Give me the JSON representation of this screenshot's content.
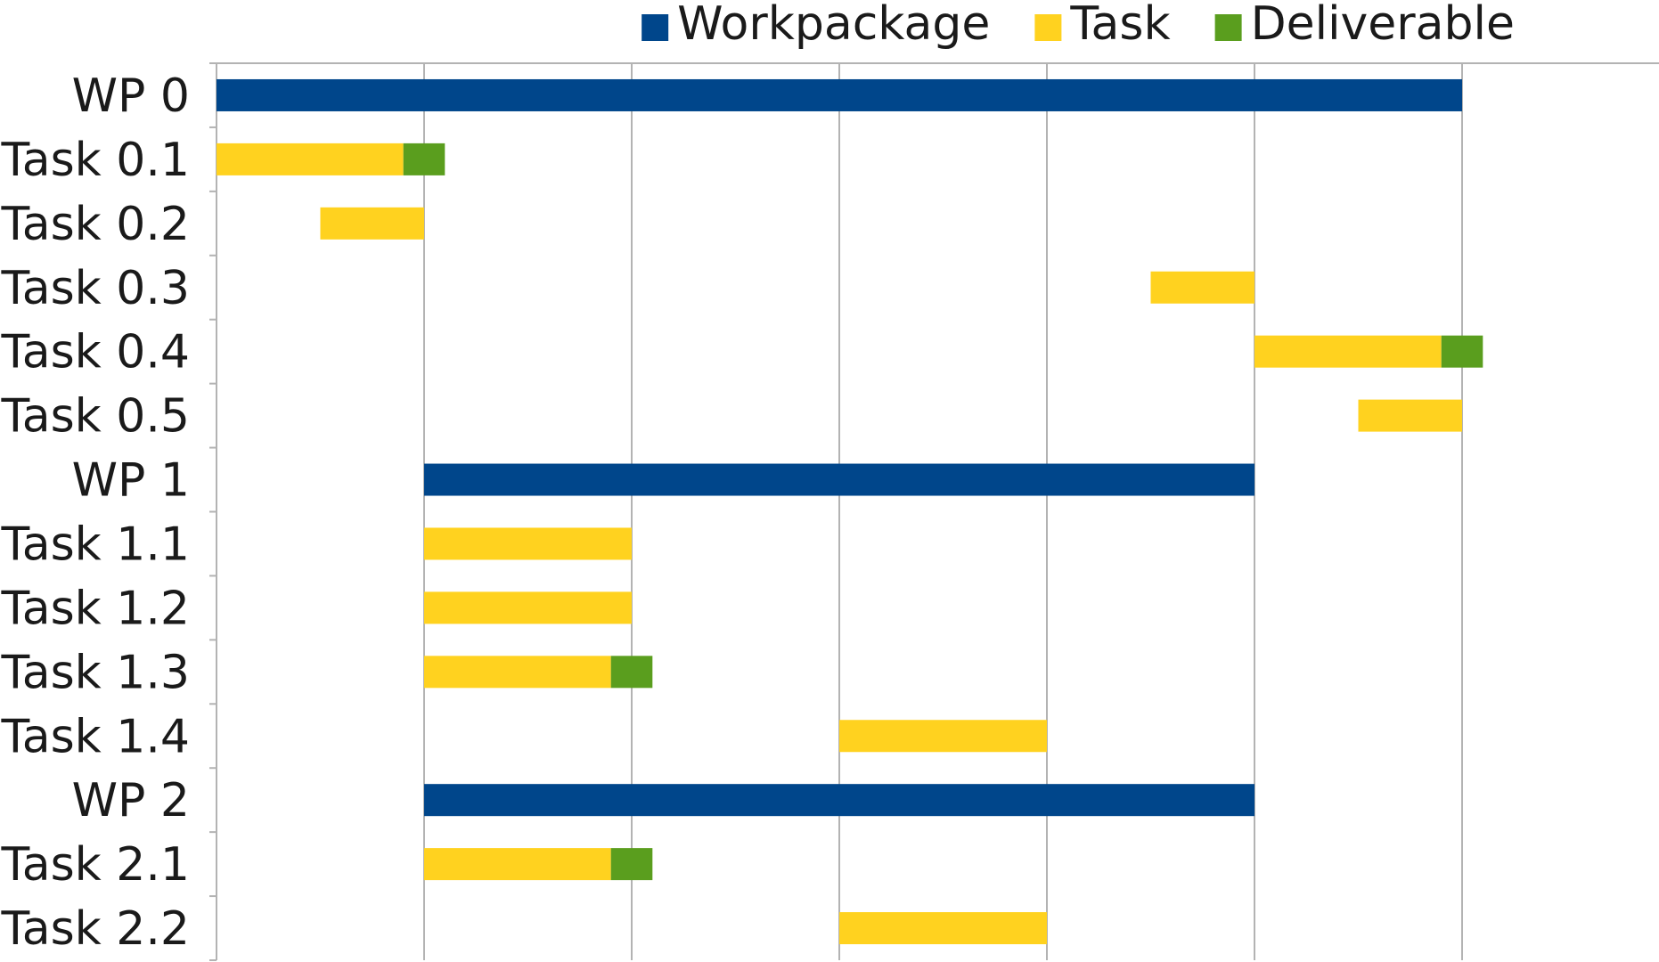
{
  "chart_data": {
    "type": "bar",
    "subtype": "gantt",
    "title": "",
    "xlabel": "",
    "ylabel": "",
    "xlim": [
      0,
      6
    ],
    "grid": "vertical",
    "legend_position": "top",
    "categories": [
      "WP 0",
      "Task 0.1",
      "Task 0.2",
      "Task 0.3",
      "Task 0.4",
      "Task 0.5",
      "WP 1",
      "Task 1.1",
      "Task 1.2",
      "Task 1.3",
      "Task 1.4",
      "WP 2",
      "Task 2.1",
      "Task 2.2"
    ],
    "series": [
      {
        "name": "Workpackage",
        "color": "#00468b",
        "bars": [
          {
            "category": "WP 0",
            "start": 0,
            "end": 6
          },
          {
            "category": "WP 1",
            "start": 1,
            "end": 5
          },
          {
            "category": "WP 2",
            "start": 1,
            "end": 5
          }
        ]
      },
      {
        "name": "Task",
        "color": "#ffd21f",
        "bars": [
          {
            "category": "Task 0.1",
            "start": 0,
            "end": 0.9
          },
          {
            "category": "Task 0.2",
            "start": 0.5,
            "end": 1
          },
          {
            "category": "Task 0.3",
            "start": 4.5,
            "end": 5
          },
          {
            "category": "Task 0.4",
            "start": 5,
            "end": 5.9
          },
          {
            "category": "Task 0.5",
            "start": 5.5,
            "end": 6
          },
          {
            "category": "Task 1.1",
            "start": 1,
            "end": 2
          },
          {
            "category": "Task 1.2",
            "start": 1,
            "end": 2
          },
          {
            "category": "Task 1.3",
            "start": 1,
            "end": 1.9
          },
          {
            "category": "Task 1.4",
            "start": 3,
            "end": 4
          },
          {
            "category": "Task 2.1",
            "start": 1,
            "end": 1.9
          },
          {
            "category": "Task 2.2",
            "start": 3,
            "end": 4
          }
        ]
      },
      {
        "name": "Deliverable",
        "color": "#5a9e1e",
        "bars": [
          {
            "category": "Task 0.1",
            "start": 0.9,
            "end": 1.1
          },
          {
            "category": "Task 0.4",
            "start": 5.9,
            "end": 6.1
          },
          {
            "category": "Task 1.3",
            "start": 1.9,
            "end": 2.1
          },
          {
            "category": "Task 2.1",
            "start": 1.9,
            "end": 2.1
          }
        ]
      }
    ]
  }
}
